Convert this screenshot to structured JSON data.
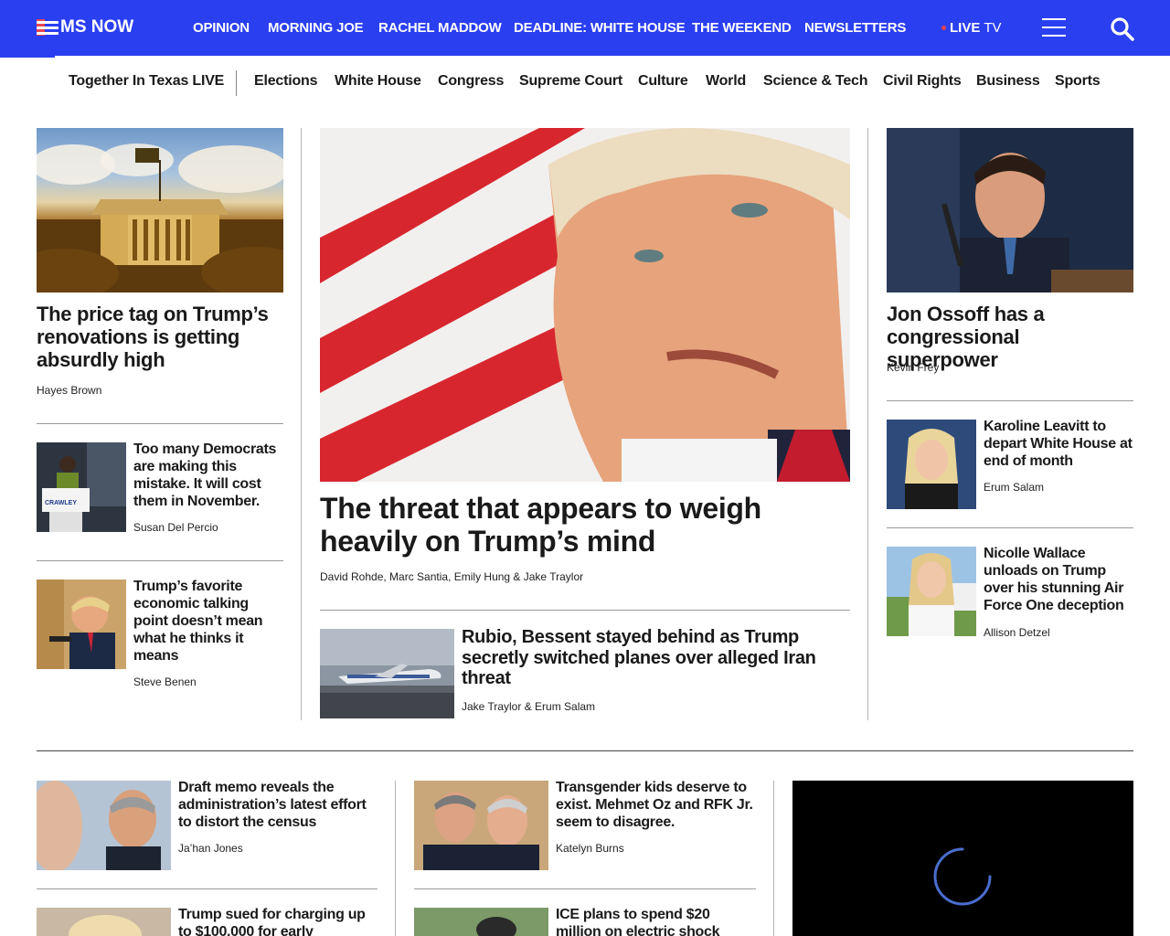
{
  "brand": {
    "logo_text": "MS NOW"
  },
  "topnav": {
    "items": [
      "OPINION",
      "MORNING JOE",
      "RACHEL MADDOW",
      "DEADLINE: WHITE HOUSE",
      "THE WEEKEND",
      "NEWSLETTERS"
    ],
    "live_bold": "LIVE",
    "live_rest": "TV",
    "menu_icon": "hamburger-icon",
    "search_icon": "search-icon"
  },
  "subnav": {
    "items": [
      "Together In Texas LIVE",
      "Elections",
      "White House",
      "Congress",
      "Supreme Court",
      "Culture",
      "World",
      "Science & Tech",
      "Civil Rights",
      "Business",
      "Sports"
    ]
  },
  "left": {
    "lead": {
      "headline": "The price tag on Trump’s renovations is getting absurdly high",
      "byline": "Hayes Brown"
    },
    "story1": {
      "headline": "Too many Democrats are making this mistake. It will cost them in November.",
      "byline": "Susan Del Percio"
    },
    "story2": {
      "headline": "Trump’s favorite economic talking point doesn’t mean what he thinks it means",
      "byline": "Steve Benen"
    }
  },
  "center": {
    "lead": {
      "headline": "The threat that appears to weigh heavily on Trump’s mind",
      "byline": "David Rohde, Marc Santia, Emily Hung & Jake Traylor"
    },
    "story1": {
      "headline": "Rubio, Bessent stayed behind as Trump secretly switched planes over alleged Iran threat",
      "byline": "Jake Traylor & Erum Salam"
    }
  },
  "right": {
    "lead": {
      "headline": "Jon Ossoff has a congressional superpower",
      "byline": "Kevin Frey"
    },
    "story1": {
      "headline": "Karoline Leavitt to depart White House at end of month",
      "byline": "Erum Salam"
    },
    "story2": {
      "headline": "Nicolle Wallace unloads on Trump over his stunning Air Force One deception",
      "byline": "Allison Detzel"
    }
  },
  "bottom": {
    "col1": {
      "story1": {
        "headline": "Draft memo reveals the administration’s latest effort to distort the census",
        "byline": "Ja’han Jones"
      },
      "story2": {
        "headline": "Trump sued for charging up to $100,000 for early"
      }
    },
    "col2": {
      "story1": {
        "headline": "Transgender kids deserve to exist. Mehmet Oz and RFK Jr. seem to disagree.",
        "byline": "Katelyn Burns"
      },
      "story2": {
        "headline": "ICE plans to spend $20 million on electric shock"
      }
    },
    "video": {
      "state": "loading"
    }
  },
  "colors": {
    "brand_blue": "#2a3ff0",
    "brand_red": "#e8424f",
    "text": "#1a1a1a"
  }
}
